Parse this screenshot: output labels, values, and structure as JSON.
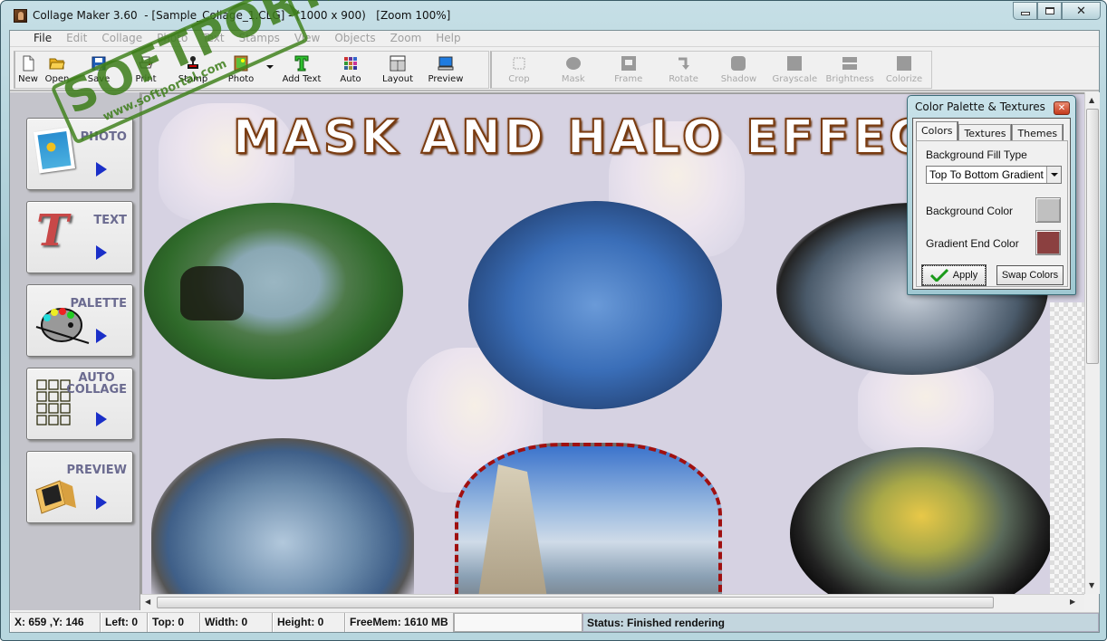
{
  "window": {
    "title": "Collage Maker 3.60  - [Sample_Collage_1.CLG] - (1000 x 900)   [Zoom 100%]"
  },
  "menu": [
    "File",
    "Edit",
    "Collage",
    "Photo",
    "Text",
    "Stamps",
    "View",
    "Objects",
    "Zoom",
    "Help"
  ],
  "toolbar": {
    "main": [
      {
        "label": "New",
        "icon": "new-document-icon"
      },
      {
        "label": "Open",
        "icon": "open-folder-icon"
      },
      {
        "label": "Save",
        "icon": "floppy-disk-icon"
      },
      {
        "label": "Print",
        "icon": "printer-icon"
      },
      {
        "label": "Stamp",
        "icon": "stamp-icon"
      },
      {
        "label": "Photo",
        "icon": "photo-icon"
      },
      {
        "label": "Add Text",
        "icon": "text-t-icon"
      },
      {
        "label": "Auto",
        "icon": "color-grid-icon"
      },
      {
        "label": "Layout",
        "icon": "layout-icon"
      },
      {
        "label": "Preview",
        "icon": "monitor-icon"
      }
    ],
    "effects": [
      {
        "label": "Crop",
        "icon": "crop-icon"
      },
      {
        "label": "Mask",
        "icon": "mask-icon"
      },
      {
        "label": "Frame",
        "icon": "frame-icon"
      },
      {
        "label": "Rotate",
        "icon": "rotate-icon"
      },
      {
        "label": "Shadow",
        "icon": "shadow-icon"
      },
      {
        "label": "Grayscale",
        "icon": "grayscale-icon"
      },
      {
        "label": "Brightness",
        "icon": "brightness-icon"
      },
      {
        "label": "Colorize",
        "icon": "colorize-icon"
      }
    ]
  },
  "left_panel": [
    {
      "label": "PHOTO",
      "icon": "photo-icon"
    },
    {
      "label": "TEXT",
      "icon": "text-t-icon"
    },
    {
      "label": "PALETTE",
      "icon": "palette-icon"
    },
    {
      "label": "AUTO\nCOLLAGE",
      "icon": "grid-icon"
    },
    {
      "label": "PREVIEW",
      "icon": "monitor-icon"
    }
  ],
  "canvas": {
    "heading": "MASK AND HALO EFFECTS",
    "background_color": "#d6d2e2"
  },
  "watermark": {
    "text": "SOFTPORTAL",
    "url": "www.softportal.com"
  },
  "dialog": {
    "title": "Color Palette & Textures",
    "tabs": [
      "Colors",
      "Textures",
      "Themes"
    ],
    "active_tab": "Colors",
    "fill_type_label": "Background Fill Type",
    "fill_type_value": "Top To Bottom Gradient",
    "bg_color_label": "Background Color",
    "bg_color": "#c0c0c0",
    "gradient_end_label": "Gradient End Color",
    "gradient_end_color": "#8b4040",
    "apply_label": "Apply",
    "swap_label": "Swap Colors"
  },
  "status": {
    "coords": "X: 659 ,Y: 146",
    "left": "Left: 0",
    "top": "Top: 0",
    "width": "Width: 0",
    "height": "Height: 0",
    "freemem": "FreeMem: 1610 MB",
    "blank": "",
    "message": "Status: Finished rendering"
  }
}
